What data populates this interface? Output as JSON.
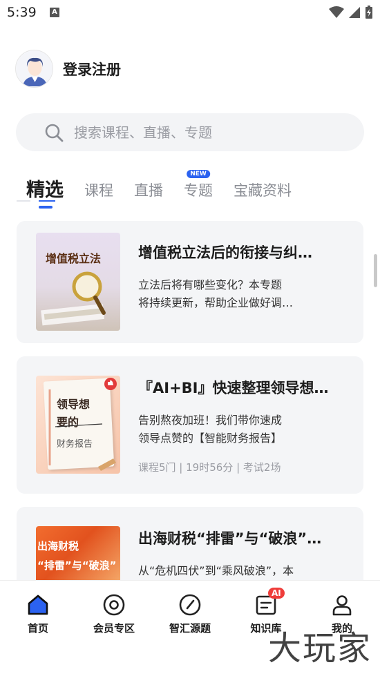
{
  "status": {
    "time": "5:39"
  },
  "profile": {
    "login_label": "登录注册"
  },
  "search": {
    "placeholder": "搜索课程、直播、专题"
  },
  "tabs": [
    {
      "label": "精选",
      "active": true
    },
    {
      "label": "课程"
    },
    {
      "label": "直播"
    },
    {
      "label": "专题",
      "badge": "NEW"
    },
    {
      "label": "宝藏资料"
    }
  ],
  "cards": [
    {
      "thumb_text": "增值税立法",
      "title": "增值税立法后的衔接与纠…",
      "desc_lines": [
        "立法后将有哪些变化？本专题",
        "将持续更新，帮助企业做好调…"
      ]
    },
    {
      "thumb_text_1": "领导想",
      "thumb_text_2": "要的",
      "thumb_text_3": "财务报告",
      "title": "『AI+BI』快速整理领导想…",
      "desc_lines": [
        "告别熬夜加班！我们带你速成",
        "领导点赞的【智能财务报告】"
      ],
      "meta": "课程5门 | 19时56分 | 考试2场"
    },
    {
      "thumb_text_1": "出海财税",
      "thumb_text_2": "“排雷”与“破浪”",
      "title": "出海财税“排雷”与“破浪”…",
      "desc_lines": [
        "从“危机四伏”到“乘风破浪”，本"
      ]
    }
  ],
  "nav": [
    {
      "label": "首页",
      "icon": "home-icon"
    },
    {
      "label": "会员专区",
      "icon": "member-icon"
    },
    {
      "label": "智汇源题",
      "icon": "compass-icon"
    },
    {
      "label": "知识库",
      "icon": "knowledge-icon",
      "badge": "AI"
    },
    {
      "label": "我的",
      "icon": "profile-icon"
    }
  ],
  "watermark": "大玩家",
  "colors": {
    "accent": "#2b62f0",
    "badge_red": "#ef3d3a",
    "card_bg": "#f4f5f7"
  }
}
